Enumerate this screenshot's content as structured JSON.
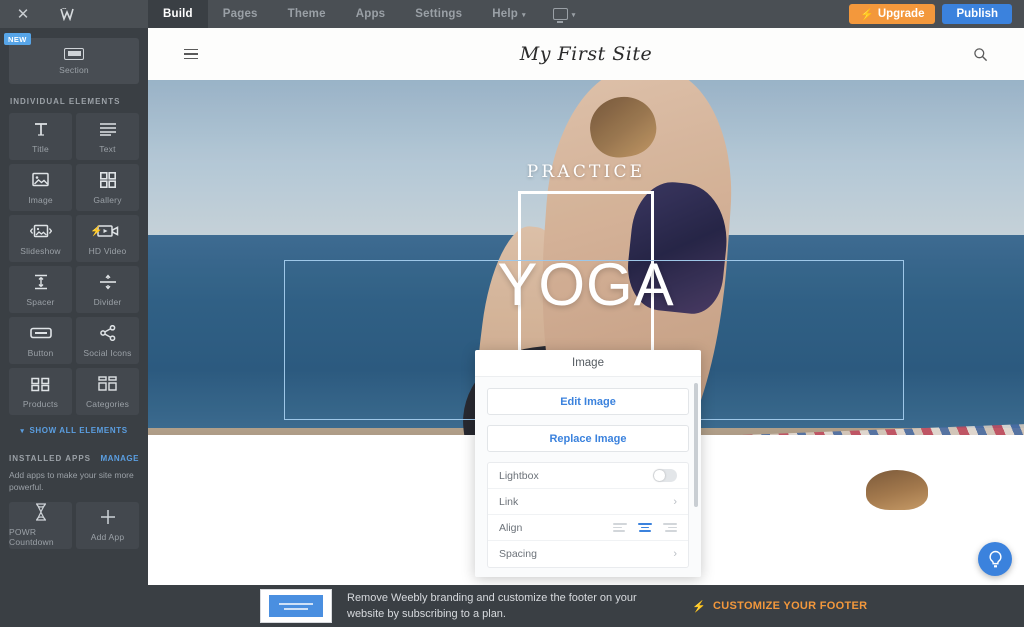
{
  "topbar": {
    "close_icon": "close-icon",
    "logo_icon": "weebly-logo-icon",
    "logo_text": "W",
    "close_text": "✕",
    "nav": [
      {
        "label": "Build",
        "active": true,
        "caret": false
      },
      {
        "label": "Pages",
        "active": false,
        "caret": false
      },
      {
        "label": "Theme",
        "active": false,
        "caret": false
      },
      {
        "label": "Apps",
        "active": false,
        "caret": false
      },
      {
        "label": "Settings",
        "active": false,
        "caret": false
      },
      {
        "label": "Help",
        "active": false,
        "caret": true
      }
    ],
    "device_icon": "monitor-icon",
    "device_caret": "▾",
    "upgrade_label": "Upgrade",
    "upgrade_icon": "bolt-icon",
    "publish_label": "Publish",
    "upgrade_color": "#f3983c",
    "publish_color": "#3b82dd"
  },
  "sidebar": {
    "section_tile": {
      "label": "Section",
      "badge": "NEW",
      "icon": "section-icon"
    },
    "group_title": "INDIVIDUAL ELEMENTS",
    "elements": [
      {
        "label": "Title",
        "icon": "title-icon",
        "pro": false
      },
      {
        "label": "Text",
        "icon": "text-icon",
        "pro": false
      },
      {
        "label": "Image",
        "icon": "image-icon",
        "pro": false
      },
      {
        "label": "Gallery",
        "icon": "gallery-icon",
        "pro": false
      },
      {
        "label": "Slideshow",
        "icon": "slideshow-icon",
        "pro": false
      },
      {
        "label": "HD Video",
        "icon": "hd-video-icon",
        "pro": true
      },
      {
        "label": "Spacer",
        "icon": "spacer-icon",
        "pro": false
      },
      {
        "label": "Divider",
        "icon": "divider-icon",
        "pro": false
      },
      {
        "label": "Button",
        "icon": "button-icon",
        "pro": false
      },
      {
        "label": "Social Icons",
        "icon": "social-icons-icon",
        "pro": false
      },
      {
        "label": "Products",
        "icon": "products-icon",
        "pro": false
      },
      {
        "label": "Categories",
        "icon": "categories-icon",
        "pro": false
      }
    ],
    "show_all_label": "SHOW ALL ELEMENTS",
    "show_all_caret": "▾",
    "apps_title": "INSTALLED APPS",
    "apps_manage": "MANAGE",
    "apps_desc": "Add apps to make your site more powerful.",
    "apps": [
      {
        "label": "POWR Countdown",
        "icon": "hourglass-icon"
      },
      {
        "label": "Add App",
        "icon": "plus-icon"
      }
    ],
    "link_color": "#5b9fe2"
  },
  "site": {
    "menu_icon": "hamburger-menu-icon",
    "title": "My First Site",
    "search_icon": "search-icon",
    "hero": {
      "eyebrow": "PRACTICE",
      "headline": "YOGA"
    }
  },
  "panel": {
    "title": "Image",
    "edit_label": "Edit Image",
    "replace_label": "Replace Image",
    "rows": [
      {
        "label": "Lightbox",
        "control": "toggle",
        "value": "off"
      },
      {
        "label": "Link",
        "control": "chevron",
        "value": "›"
      },
      {
        "label": "Align",
        "control": "align",
        "value": "center"
      },
      {
        "label": "Spacing",
        "control": "chevron",
        "value": "›"
      }
    ],
    "accent_color": "#3b82dd"
  },
  "help": {
    "icon": "lightbulb-icon"
  },
  "footer": {
    "thumb_icon": "footer-preview-thumbnail",
    "text": "Remove Weebly branding and customize the footer on your website by subscribing to a plan.",
    "cta_label": "CUSTOMIZE YOUR FOOTER",
    "cta_icon": "bolt-icon",
    "cta_color": "#f3983c"
  }
}
